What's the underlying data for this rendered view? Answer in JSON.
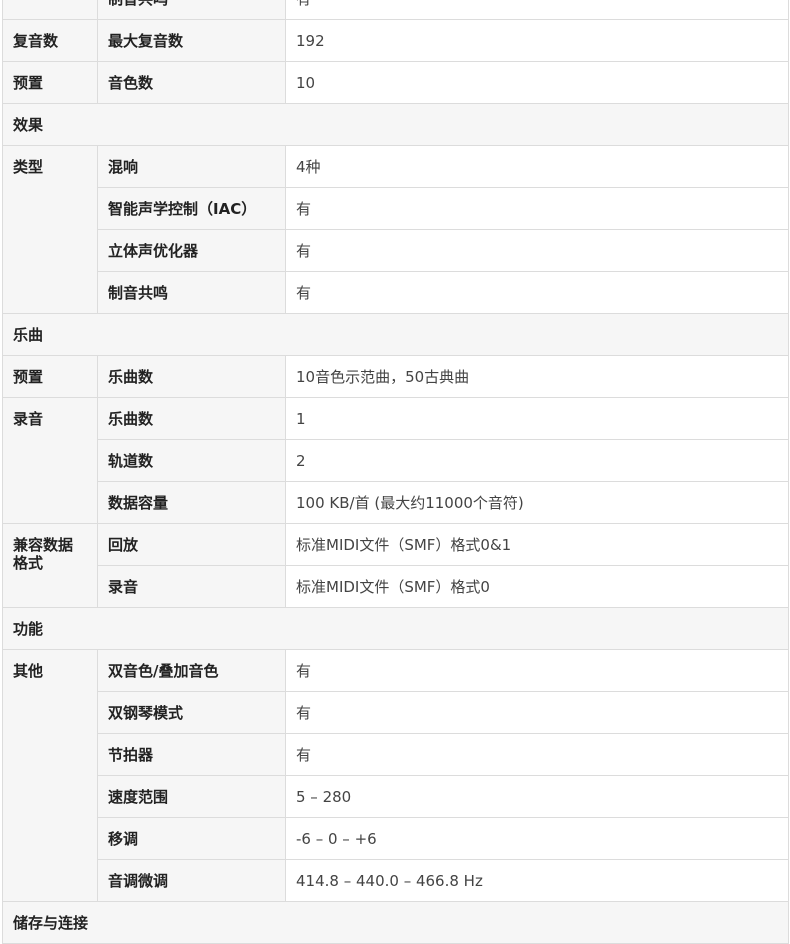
{
  "partial_top": {
    "item": "制音共鸣",
    "value": "有"
  },
  "rows_polyphony": {
    "category": "复音数",
    "item": "最大复音数",
    "value": "192"
  },
  "rows_preset_voices": {
    "category": "预置",
    "item": "音色数",
    "value": "10"
  },
  "section_effects": "效果",
  "effects": {
    "category": "类型",
    "items": [
      {
        "item": "混响",
        "value": "4种"
      },
      {
        "item": "智能声学控制（IAC）",
        "value": "有"
      },
      {
        "item": "立体声优化器",
        "value": "有"
      },
      {
        "item": "制音共鸣",
        "value": "有"
      }
    ]
  },
  "section_songs": "乐曲",
  "songs_preset": {
    "category": "预置",
    "item": "乐曲数",
    "value": "10音色示范曲，50古典曲"
  },
  "songs_recording": {
    "category": "录音",
    "items": [
      {
        "item": "乐曲数",
        "value": "1"
      },
      {
        "item": "轨道数",
        "value": "2"
      },
      {
        "item": "数据容量",
        "value": "100 KB/首 (最大约11000个音符)"
      }
    ]
  },
  "compat": {
    "category": "兼容数据格式",
    "items": [
      {
        "item": "回放",
        "value": "标准MIDI文件（SMF）格式0&1"
      },
      {
        "item": "录音",
        "value": "标准MIDI文件（SMF）格式0"
      }
    ]
  },
  "section_functions": "功能",
  "functions": {
    "category": "其他",
    "items": [
      {
        "item": "双音色/叠加音色",
        "value": "有"
      },
      {
        "item": "双钢琴模式",
        "value": "有"
      },
      {
        "item": "节拍器",
        "value": "有"
      },
      {
        "item": "速度范围",
        "value": "5 – 280"
      },
      {
        "item": "移调",
        "value": "-6 – 0 – +6"
      },
      {
        "item": "音调微调",
        "value": "414.8 – 440.0 – 466.8 Hz"
      }
    ]
  },
  "section_storage": "储存与连接"
}
